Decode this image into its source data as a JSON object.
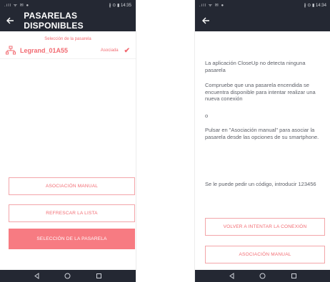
{
  "screen1": {
    "status": {
      "left": "⁠.ıll ⁠ᯤ ⁠✉ ⁠●",
      "right": "∦ ⊙ ▮ 14:35"
    },
    "title": "PASARELAS DISPONIBLES",
    "section_label": "Selección de la pasarela",
    "gateways": [
      {
        "name": "Legrand_01A55",
        "status": "Asociada",
        "selected": true
      }
    ],
    "buttons": {
      "manual": "ASOCIACIÓN MANUAL",
      "refresh": "REFRESCAR LA LISTA",
      "select": "SELECCIÓN DE LA PASARELA"
    }
  },
  "screen2": {
    "status": {
      "left": "⁠.ıll ⁠ᯤ ⁠✉ ⁠●",
      "right": "∦ ⊙ ▮ 14:34"
    },
    "messages": [
      "La aplicación CloseUp no detecta ninguna pasarela",
      "Compruebe que una pasarela encendida se encuentra disponible para intentar realizar una nueva conexión",
      "o",
      "Pulsar en \"Asociación manual\" para asociar la pasarela desde las opciones de su smartphone.",
      "Se le puede pedir un código, introducir 123456"
    ],
    "buttons": {
      "retry": "VOLVER A INTENTAR LA CONEXIÓN",
      "manual": "ASOCIACIÓN MANUAL"
    }
  },
  "colors": {
    "appbar": "#242833",
    "accent": "#f26b72",
    "accent_fill": "#f77b82"
  },
  "icons": {
    "back": "arrow-left-icon",
    "gateway": "network-icon",
    "selected": "checkmark-icon"
  }
}
